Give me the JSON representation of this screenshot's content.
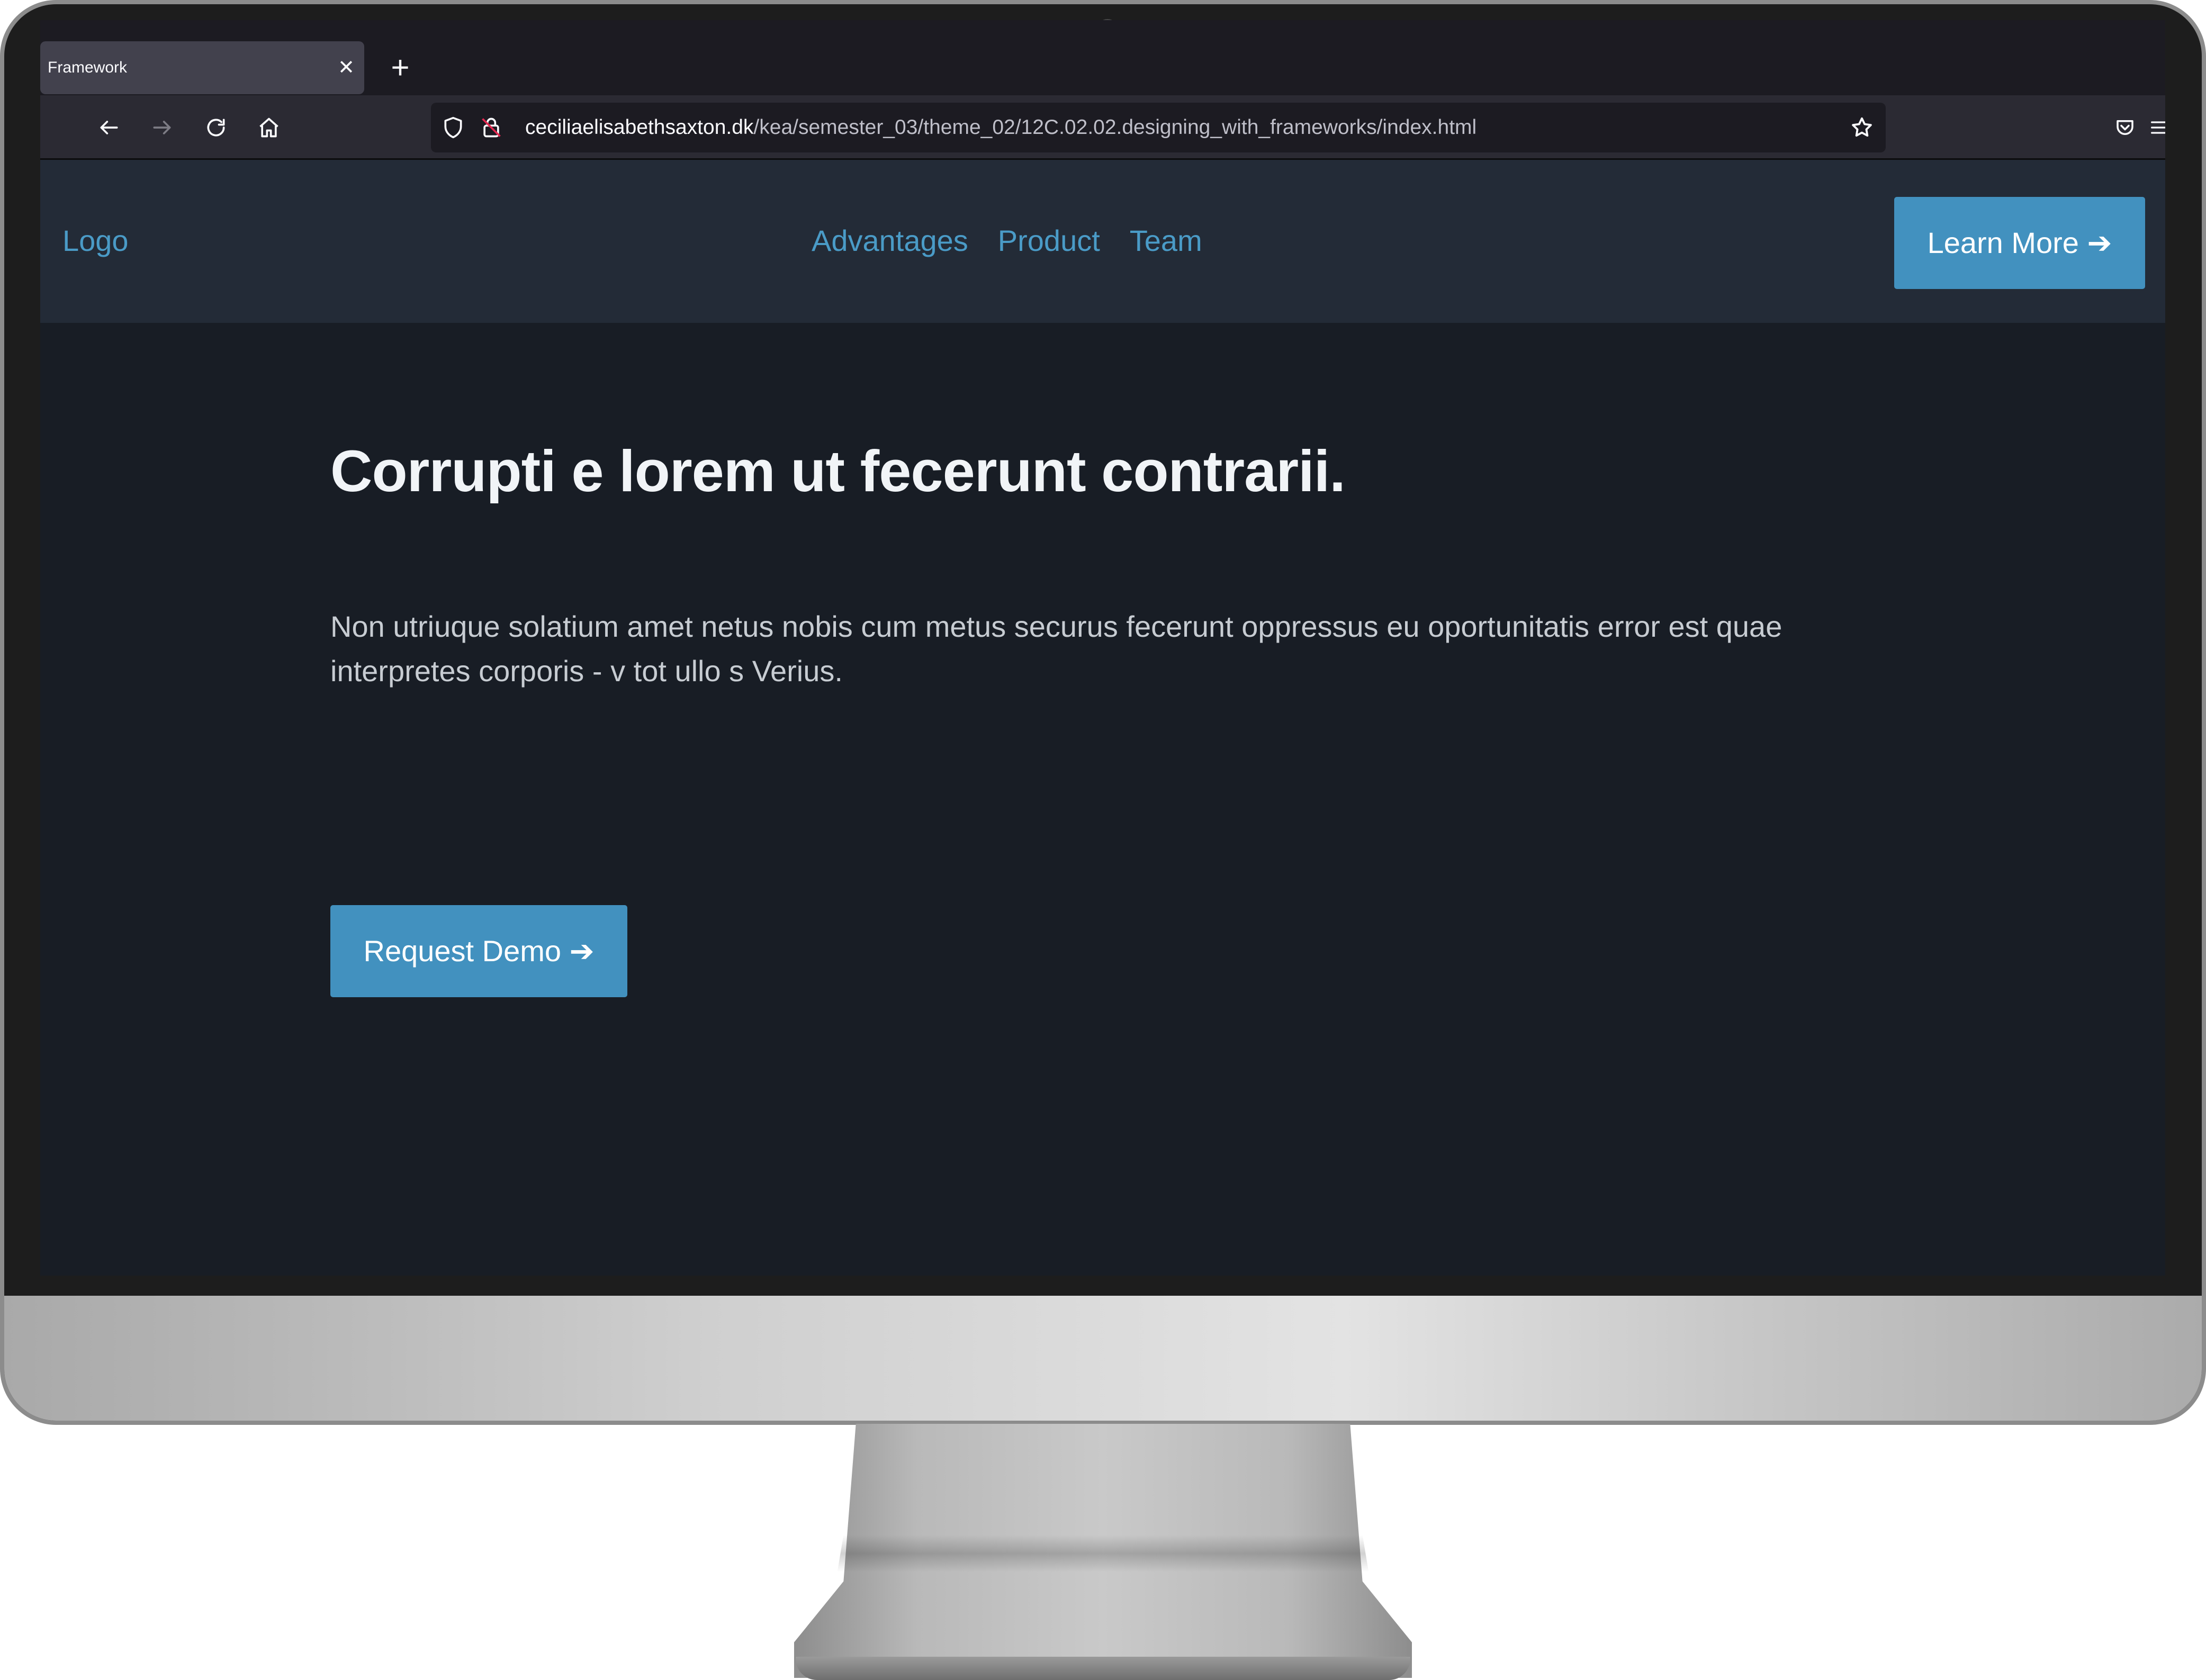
{
  "browser": {
    "tab_title": "Framework",
    "tab_close": "✕",
    "new_tab": "+",
    "url_host": "ceciliaelisabethsaxton.dk",
    "url_path": "/kea/semester_03/theme_02/12C.02.02.designing_with_frameworks/index.html"
  },
  "site": {
    "logo": "Logo",
    "nav": [
      "Advantages",
      "Product",
      "Team"
    ],
    "learn_more": "Learn More ➔",
    "hero_title": "Corrupti e lorem ut fecerunt contrarii.",
    "hero_text": "Non utriuque solatium amet netus nobis cum metus securus fecerunt oppressus eu oportunitatis error est quae interpretes corporis - v tot ullo s Verius.",
    "request_demo": "Request Demo ➔"
  },
  "colors": {
    "accent": "#4291bf",
    "link": "#4a9bc7",
    "page_bg": "#181d25",
    "header_bg": "#232b37"
  },
  "icons": [
    "back-arrow-icon",
    "forward-arrow-icon",
    "reload-icon",
    "home-icon",
    "shield-icon",
    "insecure-lock-icon",
    "bookmark-star-icon",
    "pocket-icon",
    "menu-icon",
    "close-icon",
    "plus-icon"
  ]
}
